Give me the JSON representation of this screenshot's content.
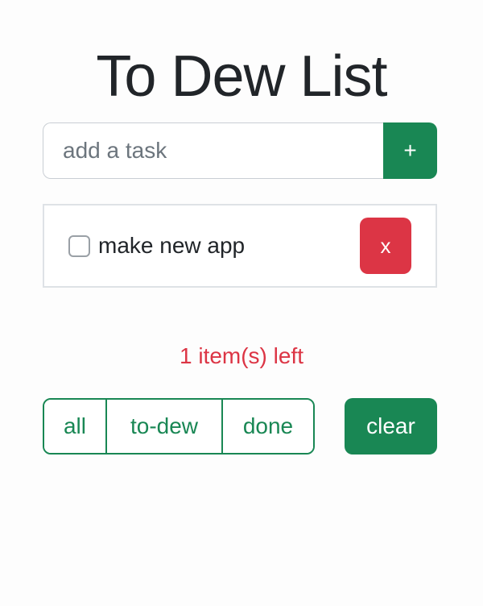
{
  "app": {
    "title": "To Dew List"
  },
  "new_task": {
    "placeholder": "add a task",
    "value": "",
    "add_label": "+"
  },
  "tasks": [
    {
      "text": "make new app",
      "done": false,
      "delete_label": "x"
    }
  ],
  "footer": {
    "items_left": "1 item(s) left",
    "filters": [
      {
        "label": "all"
      },
      {
        "label": "to-dew"
      },
      {
        "label": "done"
      }
    ],
    "clear_label": "clear"
  },
  "colors": {
    "primary_green": "#198754",
    "danger_red": "#dc3545",
    "text_dark": "#212529",
    "placeholder_gray": "#6c757d",
    "border_gray": "#dee2e6"
  }
}
